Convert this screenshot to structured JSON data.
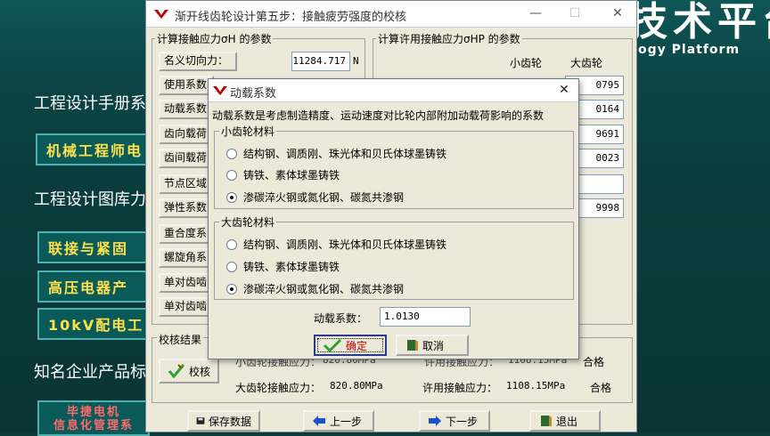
{
  "background": {
    "title_cn": "机械工程技术平台",
    "title_en": "ogy Platform",
    "links": [
      {
        "text": "工程设计手册系"
      },
      {
        "text": "工程设计图库力"
      },
      {
        "text": "知名企业产品标"
      }
    ],
    "buttons": [
      {
        "text": "机械工程师电"
      },
      {
        "text": "联接与紧固"
      },
      {
        "text": "高压电器产"
      },
      {
        "text": "10kV配电工"
      },
      {
        "text": "毕捷电机\n信息化管理系"
      }
    ]
  },
  "main_window": {
    "title": "渐开线齿轮设计第五步：接触疲劳强度的校核",
    "controls": {
      "minimize": "—",
      "maximize": "☐",
      "close": "✕"
    },
    "left_group": {
      "title": "计算接触应力σH 的参数",
      "rows": [
        {
          "label": "名义切向力：",
          "value": "11284.717",
          "unit": "N"
        },
        {
          "label": "使用系数",
          "value": ""
        },
        {
          "label": "动载系数",
          "value": ""
        },
        {
          "label": "齿向载荷",
          "value": ""
        },
        {
          "label": "齿间载荷",
          "value": ""
        },
        {
          "label": "节点区域",
          "value": ""
        },
        {
          "label": "弹性系数",
          "value": ""
        },
        {
          "label": "重合度系",
          "value": ""
        },
        {
          "label": "螺旋角系",
          "value": ""
        },
        {
          "label": "单对齿啮",
          "value": ""
        },
        {
          "label": "单对齿啮",
          "value": ""
        }
      ]
    },
    "right_group": {
      "title": "计算许用接触应力σHP 的参数",
      "col_small": "小齿轮",
      "col_large": "大齿轮",
      "large_values": [
        "0795",
        "0164",
        "9691",
        "0023",
        "",
        "9998"
      ]
    },
    "result": {
      "title": "校核结果",
      "check_button": "校核",
      "line1_left": "小齿轮接触应力：",
      "line1_left_value": "820.80MPa",
      "line1_right": "许用接触应力：",
      "line1_right_value": "1108.15MPa",
      "line1_status": "合格",
      "line2_left": "大齿轮接触应力：",
      "line2_left_value": "820.80MPa",
      "line2_right": "许用接触应力：",
      "line2_right_value": "1108.15MPa",
      "line2_status": "合格"
    },
    "footer": {
      "save": "保存数据",
      "prev": "上一步",
      "next": "下一步",
      "exit": "退出"
    }
  },
  "dialog": {
    "title": "动载系数",
    "close": "✕",
    "description": "动载系数是考虑制造精度、运动速度对比轮内部附加动载荷影响的系数",
    "small_gear": {
      "title": "小齿轮材料",
      "options": [
        {
          "label": "结构钢、调质刚、珠光体和贝氏体球墨铸铁",
          "selected": false
        },
        {
          "label": "铸铁、素体球墨铸铁",
          "selected": false
        },
        {
          "label": "渗碳淬火钢或氮化钢、碳氮共渗钢",
          "selected": true
        }
      ]
    },
    "large_gear": {
      "title": "大齿轮材料",
      "options": [
        {
          "label": "结构钢、调质刚、珠光体和贝氏体球墨铸铁",
          "selected": false
        },
        {
          "label": "铸铁、素体球墨铸铁",
          "selected": false
        },
        {
          "label": "渗碳淬火钢或氮化钢、碳氮共渗钢",
          "selected": true
        }
      ]
    },
    "coef_label": "动载系数：",
    "coef_value": "1.0130",
    "ok": "确定",
    "cancel": "取消"
  },
  "colors": {
    "bg_teal": "#0b3a3a",
    "button_yellow": "#ffe14a",
    "check_green": "#2aa52a",
    "ok_text_red": "#c00000"
  }
}
